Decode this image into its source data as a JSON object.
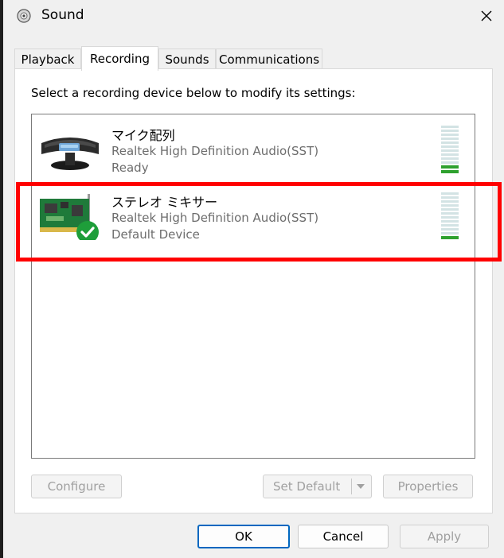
{
  "window": {
    "title": "Sound"
  },
  "tabs": [
    {
      "label": "Playback"
    },
    {
      "label": "Recording"
    },
    {
      "label": "Sounds"
    },
    {
      "label": "Communications"
    }
  ],
  "recording": {
    "instruction": "Select a recording device below to modify its settings:",
    "devices": [
      {
        "name": "マイク配列",
        "driver": "Realtek High Definition Audio(SST)",
        "status": "Ready",
        "icon": "microphone-array-icon",
        "level_segments_total": 12,
        "level_segments_lit": 2
      },
      {
        "name": "ステレオ ミキサー",
        "driver": "Realtek High Definition Audio(SST)",
        "status": "Default Device",
        "icon": "sound-card-icon",
        "badge": "default-checkmark-icon",
        "level_segments_total": 12,
        "level_segments_lit": 1
      }
    ],
    "buttons": {
      "configure": "Configure",
      "set_default": "Set Default",
      "properties": "Properties"
    }
  },
  "dialog_buttons": {
    "ok": "OK",
    "cancel": "Cancel",
    "apply": "Apply"
  },
  "colors": {
    "highlight": "#ff0000",
    "ok_border": "#0067c0",
    "level_lit": "#2ea12e",
    "check_badge": "#1e9e3a"
  }
}
